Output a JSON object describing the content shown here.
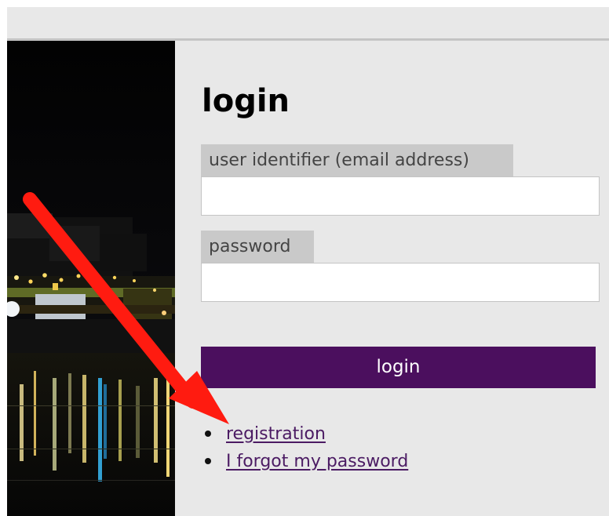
{
  "login": {
    "title": "login",
    "email_label": "user identifier (email address)",
    "email_value": "",
    "password_label": "password",
    "password_value": "",
    "submit_label": "login"
  },
  "links": [
    {
      "label": "registration"
    },
    {
      "label": "I forgot my password"
    }
  ],
  "colors": {
    "content_background": "#e8e8e8",
    "label_background": "#c9c9c9",
    "button_background": "#4b0f5e",
    "link": "#4b1b63",
    "arrow": "#ff1b10"
  },
  "icons": {
    "pointer_arrow": "red-arrow-icon",
    "list_bullets": "bullet-icon"
  }
}
